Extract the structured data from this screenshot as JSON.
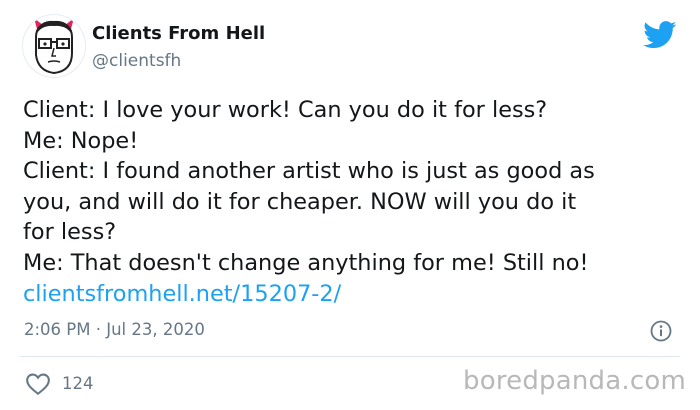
{
  "author": {
    "display_name": "Clients From Hell",
    "handle": "@clientsfh"
  },
  "tweet": {
    "lines": [
      "Client: I love your work! Can you do it for less?",
      "Me: Nope!",
      "Client: I found another artist who is just as good as",
      "you, and will do it for cheaper. NOW will you do it",
      "for less?",
      "Me: That doesn't change anything for me! Still no!"
    ],
    "link": "clientsfromhell.net/15207-2/",
    "timestamp": "2:06 PM · Jul 23, 2020"
  },
  "engagement": {
    "likes": "124"
  },
  "watermark": "boredpanda.com",
  "colors": {
    "link": "#1da1f2",
    "twitter_blue": "#1da1f2",
    "muted": "#657786",
    "horns": "#e0245e"
  },
  "icons": [
    "twitter-bird-icon",
    "info-icon",
    "heart-icon"
  ]
}
